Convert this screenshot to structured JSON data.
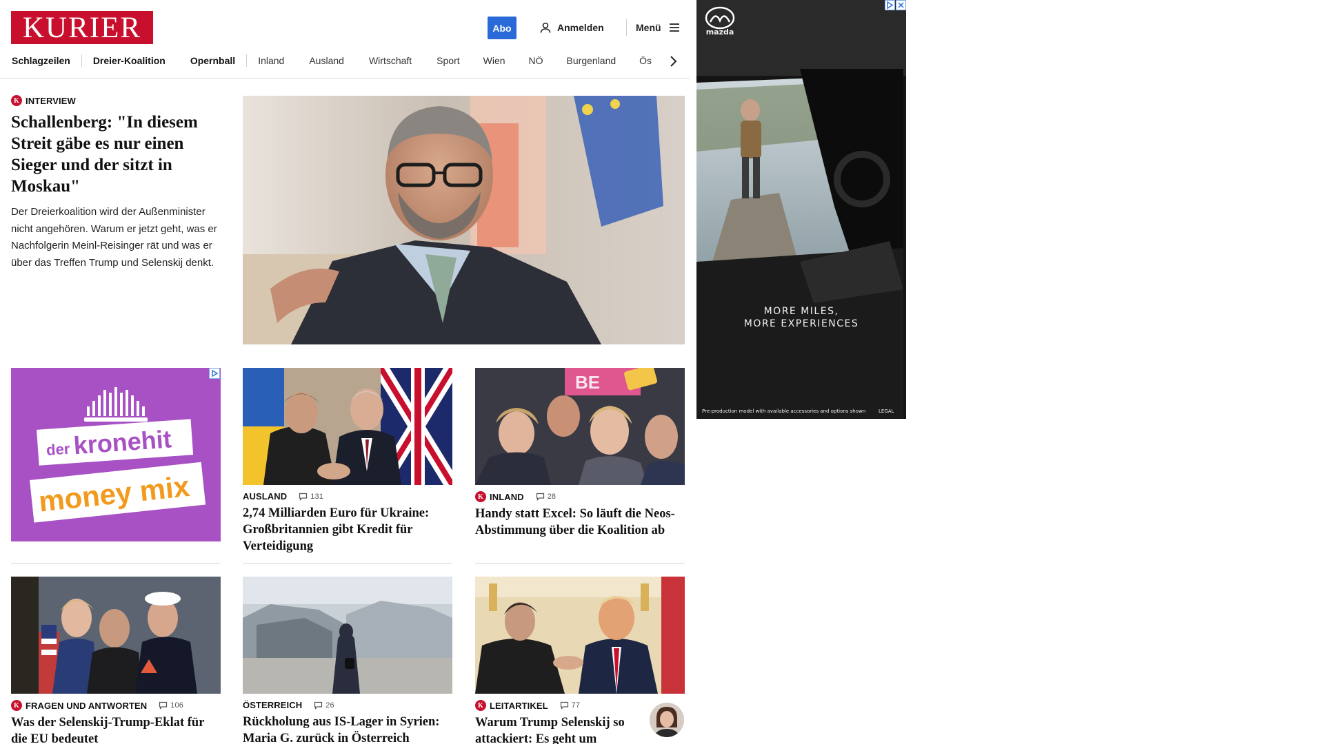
{
  "header": {
    "logo": "KURIER",
    "abo_label": "Abo",
    "login_label": "Anmelden",
    "menu_label": "Menü"
  },
  "nav": {
    "items": [
      "Schlagzeilen",
      "Dreier-Koalition",
      "Opernball",
      "Inland",
      "Ausland",
      "Wirtschaft",
      "Sport",
      "Wien",
      "NÖ",
      "Burgenland",
      "Ös"
    ]
  },
  "lead": {
    "kicker": "INTERVIEW",
    "title": "Schallenberg: \"In diesem Streit gäbe es nur einen Sieger und der sitzt in Moskau\"",
    "teaser": "Der Dreierkoalition wird der Außenminister nicht angehören. Warum er jetzt geht, was er Nachfolgerin Meinl-Reisinger rät und was er über das Treffen Trump und Selenskij denkt."
  },
  "inline_ad": {
    "brand_small": "der",
    "brand_big": "kronehit",
    "slogan": "money mix"
  },
  "cards": [
    {
      "kicker": "AUSLAND",
      "comments": "131",
      "title": "2,74 Milliarden Euro für Ukraine: Großbritannien gibt Kredit für Verteidigung",
      "premium": false
    },
    {
      "kicker": "INLAND",
      "comments": "28",
      "title": "Handy statt Excel: So läuft die Neos-Abstimmung über die Koalition ab",
      "premium": true
    },
    {
      "kicker": "FRAGEN UND ANTWORTEN",
      "comments": "106",
      "title": "Was der Selenskij-Trump-Eklat für die EU bedeutet",
      "premium": true
    },
    {
      "kicker": "ÖSTERREICH",
      "comments": "26",
      "title": "Rückholung aus IS-Lager in Syrien: Maria G. zurück in Österreich",
      "premium": false
    },
    {
      "kicker": "LEITARTIKEL",
      "comments": "77",
      "title": "Warum Trump Selenskij so attackiert: Es geht um Dollars, nicht um Frieden",
      "premium": true
    }
  ],
  "side_ad": {
    "brand": "mazda",
    "headline_1": "MORE MILES,",
    "headline_2": "MORE EXPERIENCES",
    "disclaimer": "Pre-production model with available accessories and options shown",
    "legal": "LEGAL"
  },
  "colors": {
    "brand_red": "#c8102e",
    "abo_blue": "#2a6ad8",
    "ad_purple": "#a851c4",
    "ad_orange": "#f29a1d"
  }
}
